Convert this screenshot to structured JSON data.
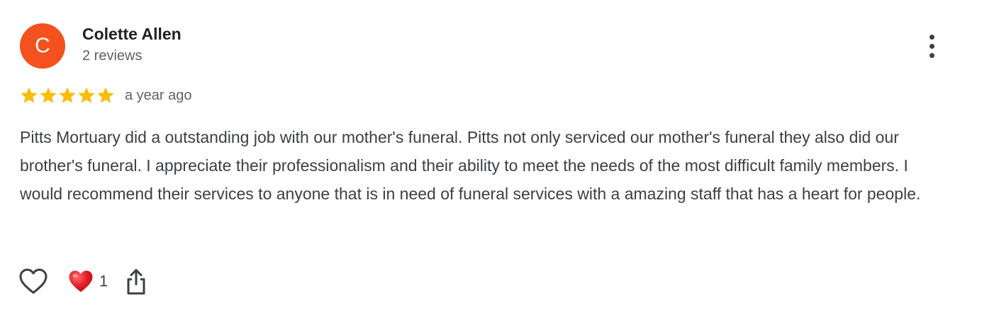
{
  "review": {
    "author": {
      "initial": "C",
      "name": "Colette Allen",
      "meta": "2 reviews",
      "avatar_color": "#f4511e"
    },
    "rating": {
      "stars": 5,
      "max": 5,
      "star_color": "#fbbc04"
    },
    "date": "a year ago",
    "text": "Pitts Mortuary did a outstanding job with our mother's funeral. Pitts not only serviced our mother's funeral they also did our brother's funeral. I appreciate their professionalism and their ability to meet the needs of the most difficult family members. I would recommend their services to anyone that is in need of funeral services with a amazing staff that has a heart for people.",
    "actions": {
      "like_icon": "heart-outline-icon",
      "reaction_icon": "red-heart-icon",
      "reaction_count": "1",
      "share_icon": "share-icon"
    },
    "menu_icon": "more-vertical-icon"
  }
}
